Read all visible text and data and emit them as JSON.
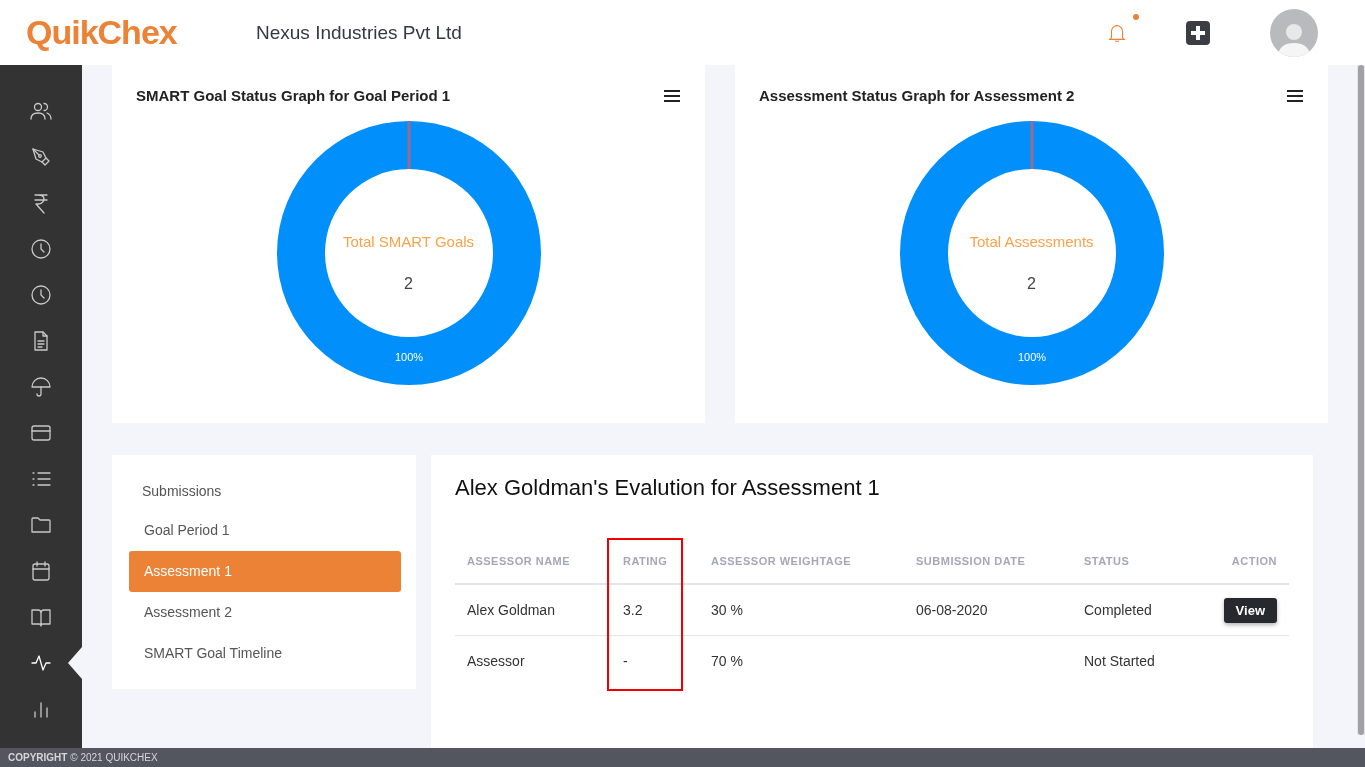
{
  "header": {
    "logo": "QuikChex",
    "company": "Nexus Industries Pvt Ltd",
    "notification_dot": true
  },
  "sidebar": {
    "items": [
      {
        "kind": "users",
        "selected": false
      },
      {
        "kind": "pen",
        "selected": false
      },
      {
        "kind": "rupee",
        "selected": false
      },
      {
        "kind": "clock",
        "selected": false
      },
      {
        "kind": "clock",
        "selected": false
      },
      {
        "kind": "document",
        "selected": false
      },
      {
        "kind": "umbrella",
        "selected": false
      },
      {
        "kind": "card",
        "selected": false
      },
      {
        "kind": "list",
        "selected": false
      },
      {
        "kind": "folder",
        "selected": false
      },
      {
        "kind": "calendar",
        "selected": false
      },
      {
        "kind": "book",
        "selected": false
      },
      {
        "kind": "activity",
        "selected": true
      },
      {
        "kind": "bars",
        "selected": false
      }
    ]
  },
  "charts": [
    {
      "title": "SMART Goal Status Graph for Goal Period 1",
      "center_label": "Total SMART Goals",
      "center_value": "2",
      "ring_label": "100%"
    },
    {
      "title": "Assessment Status Graph for Assessment 2",
      "center_label": "Total Assessments",
      "center_value": "2",
      "ring_label": "100%"
    }
  ],
  "submissions_nav": {
    "heading": "Submissions",
    "items": [
      {
        "label": "Goal Period 1",
        "selected": false
      },
      {
        "label": "Assessment 1",
        "selected": true
      },
      {
        "label": "Assessment 2",
        "selected": false
      },
      {
        "label": "SMART Goal Timeline",
        "selected": false
      }
    ]
  },
  "evaluation": {
    "title": "Alex Goldman's Evalution for Assessment 1",
    "table": {
      "columns": [
        {
          "label": "ASSESSOR NAME",
          "highlighted": false
        },
        {
          "label": "RATING",
          "highlighted": true
        },
        {
          "label": "ASSESSOR WEIGHTAGE",
          "highlighted": false
        },
        {
          "label": "SUBMISSION DATE",
          "highlighted": false
        },
        {
          "label": "STATUS",
          "highlighted": false
        },
        {
          "label": "ACTION",
          "highlighted": false
        }
      ],
      "rows": [
        {
          "cells": [
            "Alex Goldman",
            "3.2",
            "30 %",
            "06-08-2020",
            "Completed"
          ],
          "action": "View"
        },
        {
          "cells": [
            "Assessor",
            "-",
            "70 %",
            "",
            "Not Started"
          ]
        }
      ]
    }
  },
  "footer": {
    "text": "**COPYRIGHT** © 2021 QUIKCHEX"
  }
}
